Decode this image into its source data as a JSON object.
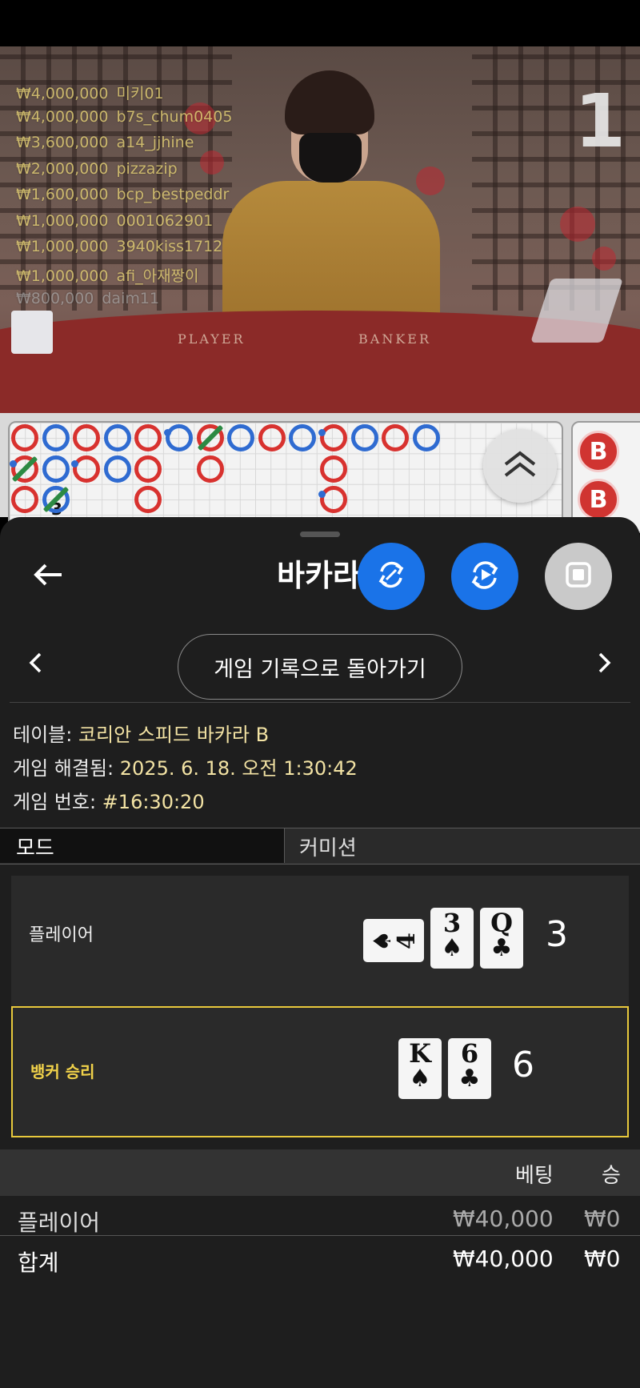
{
  "video": {
    "round_number": "1",
    "felt_player": "PLAYER",
    "felt_banker": "BANKER",
    "recent_bets": [
      {
        "amount": "₩4,000,000",
        "user": "미키01"
      },
      {
        "amount": "₩4,000,000",
        "user": "b7s_chum0405"
      },
      {
        "amount": "₩3,600,000",
        "user": "a14_jjhine"
      },
      {
        "amount": "₩2,000,000",
        "user": "pizzazip"
      },
      {
        "amount": "₩1,600,000",
        "user": "bcp_bestpeddr"
      },
      {
        "amount": "₩1,000,000",
        "user": "0001062901"
      },
      {
        "amount": "₩1,000,000",
        "user": "3940kiss1712"
      },
      {
        "amount": "₩1,000,000",
        "user": "afi_아재짱이"
      },
      {
        "amount": "₩800,000",
        "user": "daim11"
      }
    ]
  },
  "road": {
    "bead_number_label": "3",
    "side_badge_label": "B",
    "colors": {
      "banker": "#d8322f",
      "player": "#2f6bd1",
      "tie": "#2c8a43"
    }
  },
  "sheet": {
    "title": "바카라",
    "back_to_history_label": "게임 기록으로 돌아가기",
    "info": {
      "table_label": "테이블:",
      "table_value": "코리안 스피드 바카라 B",
      "resolved_label": "게임 해결됨:",
      "resolved_value": "2025. 6. 18. 오전 1:30:42",
      "game_no_label": "게임 번호:",
      "game_no_value": "#16:30:20"
    },
    "mode": {
      "label": "모드",
      "value": "커미션"
    },
    "player_hand": {
      "label": "플레이어",
      "score": "3",
      "cards": [
        {
          "rank": "4",
          "suit": "♠",
          "sideways": true
        },
        {
          "rank": "3",
          "suit": "♠"
        },
        {
          "rank": "Q",
          "suit": "♣"
        }
      ]
    },
    "banker_hand": {
      "label": "뱅커 승리",
      "score": "6",
      "cards": [
        {
          "rank": "K",
          "suit": "♠"
        },
        {
          "rank": "6",
          "suit": "♣"
        }
      ]
    },
    "bets_table": {
      "col_bet": "베팅",
      "col_win": "승",
      "rows": [
        {
          "label": "플레이어",
          "bet": "₩40,000",
          "win": "₩0"
        },
        {
          "label": "합계",
          "bet": "₩40,000",
          "win": "₩0"
        }
      ]
    }
  },
  "icons": {
    "back": "arrow-left-icon",
    "refresh": "refresh-icon",
    "replay": "play-rotate-icon",
    "stop": "stop-icon",
    "prev": "chevron-left-icon",
    "next": "chevron-right-icon",
    "scroll_up": "double-chevron-up-icon"
  }
}
